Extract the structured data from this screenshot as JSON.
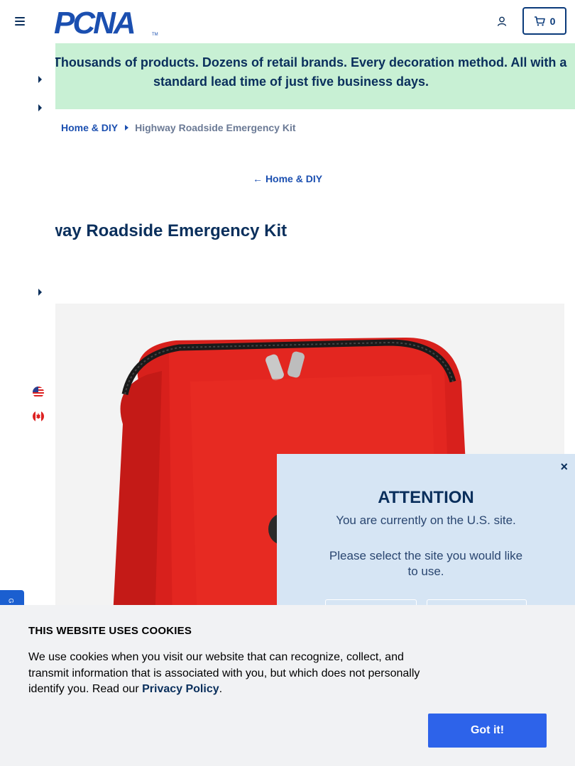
{
  "header": {
    "logo_text": "PCNA",
    "cart_count": "0",
    "icons": {
      "menu": "hamburger-menu-icon",
      "account": "user-account-icon",
      "cart": "shopping-cart-icon"
    },
    "colors": {
      "brand_navy": "#0a2f5c",
      "brand_blue": "#1b4fb0",
      "accent": "#2d63ea"
    }
  },
  "banner": {
    "text": "Wait? Thousands of products. Dozens of retail brands. Every decoration method. All with a standard lead time of just five business days.",
    "background": "#c8f0d4"
  },
  "breadcrumb": {
    "parent": "Home & DIY",
    "current": "Highway Roadside Emergency Kit"
  },
  "back_link": {
    "arrow": "←",
    "label": "Home & DIY"
  },
  "product": {
    "title": "Highway Roadside Emergency Kit"
  },
  "sidebar": {
    "flags": [
      "us-flag-icon",
      "canada-flag-icon"
    ]
  },
  "attention_popup": {
    "close": "×",
    "heading": "ATTENTION",
    "message": "You are currently on the U.S. site.",
    "prompt": "Please select the site you would like to use."
  },
  "cookie_banner": {
    "heading": "THIS WEBSITE USES COOKIES",
    "body": "We use cookies when you visit our website that can recognize, collect, and transmit information that is associated with you, but which does not personally identify you. Read our ",
    "policy_link": "Privacy Policy",
    "period": ".",
    "button": "Got it!"
  }
}
